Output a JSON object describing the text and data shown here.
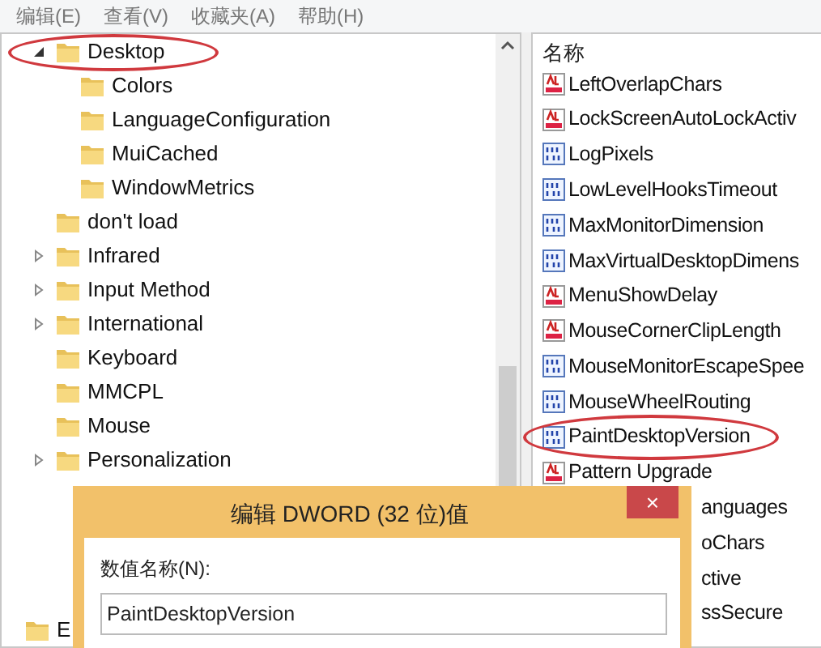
{
  "menu": [
    {
      "label": "编辑(E)"
    },
    {
      "label": "查看(V)"
    },
    {
      "label": "收藏夹(A)"
    },
    {
      "label": "帮助(H)"
    }
  ],
  "tree": {
    "branch": [
      {
        "label": "Desktop",
        "expanded": true,
        "circled": true,
        "children": [
          {
            "label": "Colors"
          },
          {
            "label": "LanguageConfiguration"
          },
          {
            "label": "MuiCached"
          },
          {
            "label": "WindowMetrics"
          }
        ]
      },
      {
        "label": "don't load",
        "circled": false
      },
      {
        "label": "Infrared",
        "expanded": false,
        "circled": false
      },
      {
        "label": "Input Method",
        "expanded": false,
        "circled": false
      },
      {
        "label": "International",
        "expanded": false,
        "circled": false
      },
      {
        "label": "Keyboard",
        "circled": false
      },
      {
        "label": "MMCPL",
        "circled": false
      },
      {
        "label": "Mouse",
        "circled": false
      },
      {
        "label": "Personalization",
        "expanded": false,
        "circled": false
      }
    ],
    "next_root": {
      "label": "E"
    }
  },
  "values": {
    "header": "名称",
    "rows": [
      {
        "name": "LeftOverlapChars",
        "kind": "string",
        "circled": false
      },
      {
        "name": "LockScreenAutoLockActiv",
        "kind": "string",
        "circled": false
      },
      {
        "name": "LogPixels",
        "kind": "binary",
        "circled": false
      },
      {
        "name": "LowLevelHooksTimeout",
        "kind": "binary",
        "circled": false
      },
      {
        "name": "MaxMonitorDimension",
        "kind": "binary",
        "circled": false
      },
      {
        "name": "MaxVirtualDesktopDimens",
        "kind": "binary",
        "circled": false
      },
      {
        "name": "MenuShowDelay",
        "kind": "string",
        "circled": false
      },
      {
        "name": "MouseCornerClipLength",
        "kind": "string",
        "circled": false
      },
      {
        "name": "MouseMonitorEscapeSpee",
        "kind": "binary",
        "circled": false
      },
      {
        "name": "MouseWheelRouting",
        "kind": "binary",
        "circled": false
      },
      {
        "name": "PaintDesktopVersion",
        "kind": "binary",
        "circled": true
      },
      {
        "name": "Pattern Upgrade",
        "kind": "string",
        "circled": false
      },
      {
        "name": "anguages",
        "kind": "covered",
        "circled": false
      },
      {
        "name": "oChars",
        "kind": "covered",
        "circled": false
      },
      {
        "name": "ctive",
        "kind": "covered",
        "circled": false
      },
      {
        "name": "ssSecure",
        "kind": "covered",
        "circled": false
      }
    ]
  },
  "dialog": {
    "title": "编辑 DWORD (32 位)值",
    "close": "×",
    "name_label": "数值名称(N):",
    "name_value": "PaintDesktopVersion"
  }
}
